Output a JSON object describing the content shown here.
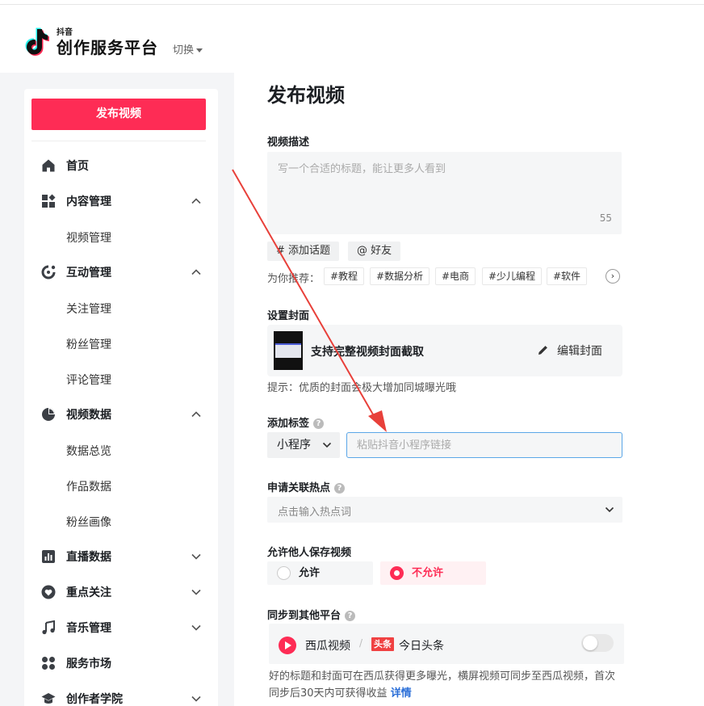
{
  "header": {
    "brand_small": "抖音",
    "brand_name": "创作服务平台",
    "switch_label": "切换"
  },
  "sidebar": {
    "publish_label": "发布视频",
    "items": [
      {
        "label": "首页",
        "icon": "home-icon"
      },
      {
        "label": "内容管理",
        "icon": "content-grid-icon",
        "chevron": "up"
      },
      {
        "label": "视频管理",
        "sub": true
      },
      {
        "label": "互动管理",
        "icon": "interaction-icon",
        "chevron": "up"
      },
      {
        "label": "关注管理",
        "sub": true
      },
      {
        "label": "粉丝管理",
        "sub": true
      },
      {
        "label": "评论管理",
        "sub": true
      },
      {
        "label": "视频数据",
        "icon": "pie-chart-icon",
        "chevron": "up"
      },
      {
        "label": "数据总览",
        "sub": true
      },
      {
        "label": "作品数据",
        "sub": true
      },
      {
        "label": "粉丝画像",
        "sub": true
      },
      {
        "label": "直播数据",
        "icon": "bar-chart-icon",
        "chevron": "down"
      },
      {
        "label": "重点关注",
        "icon": "heart-icon",
        "chevron": "down"
      },
      {
        "label": "音乐管理",
        "icon": "music-note-icon",
        "chevron": "down"
      },
      {
        "label": "服务市场",
        "icon": "services-icon"
      },
      {
        "label": "创作者学院",
        "icon": "graduation-cap-icon",
        "chevron": "down"
      }
    ]
  },
  "main": {
    "title": "发布视频",
    "description": {
      "label": "视频描述",
      "placeholder": "写一个合适的标题，能让更多人看到",
      "count": "55"
    },
    "add_topic": "# 添加话题",
    "mention_friend": "@ 好友",
    "recommend_label": "为你推荐：",
    "recommend_tags": [
      "#教程",
      "#数据分析",
      "#电商",
      "#少儿编程",
      "#软件"
    ],
    "cover": {
      "label": "设置封面",
      "text": "支持完整视频封面截取",
      "edit": "编辑封面",
      "hint": "提示：优质的封面会极大增加同城曝光哦"
    },
    "tags": {
      "label": "添加标签",
      "select_value": "小程序",
      "input_placeholder": "粘贴抖音小程序链接"
    },
    "hotspot": {
      "label": "申请关联热点",
      "placeholder": "点击输入热点词"
    },
    "save": {
      "label": "允许他人保存视频",
      "allow": "允许",
      "deny": "不允许",
      "selected": "deny"
    },
    "sync": {
      "label": "同步到其他平台",
      "xigua": "西瓜视频",
      "separator": "/",
      "toutiao_badge": "头条",
      "toutiao": "今日头条",
      "enabled": false,
      "desc": "好的标题和封面可在西瓜获得更多曝光，横屏视频可同步至西瓜视频，首次同步后30天内可获得收益",
      "more": "详情"
    }
  },
  "colors": {
    "brand": "#fe2c55",
    "link": "#2b6fd8",
    "focus_border": "#5ba7e8",
    "annotation_arrow": "#e8403a"
  }
}
